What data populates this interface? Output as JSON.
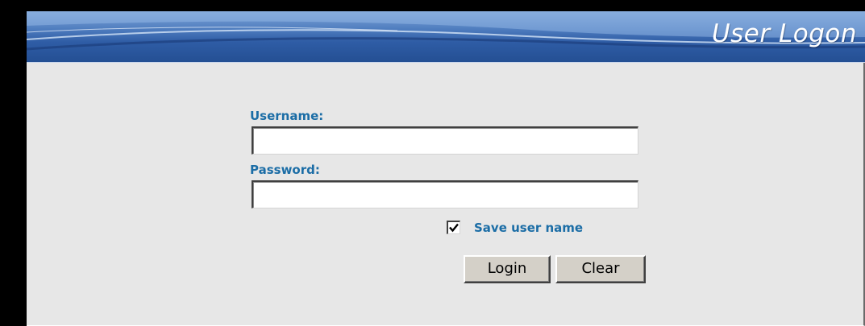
{
  "header": {
    "title": "User Logon"
  },
  "form": {
    "username_label": "Username:",
    "username_value": "",
    "password_label": "Password:",
    "password_value": "",
    "save_username_label": "Save user name",
    "save_username_checked": true,
    "login_label": "Login",
    "clear_label": "Clear"
  },
  "colors": {
    "label": "#1b6da6",
    "panel_background": "#e7e7e7",
    "header_blue": "#2f5da6"
  }
}
